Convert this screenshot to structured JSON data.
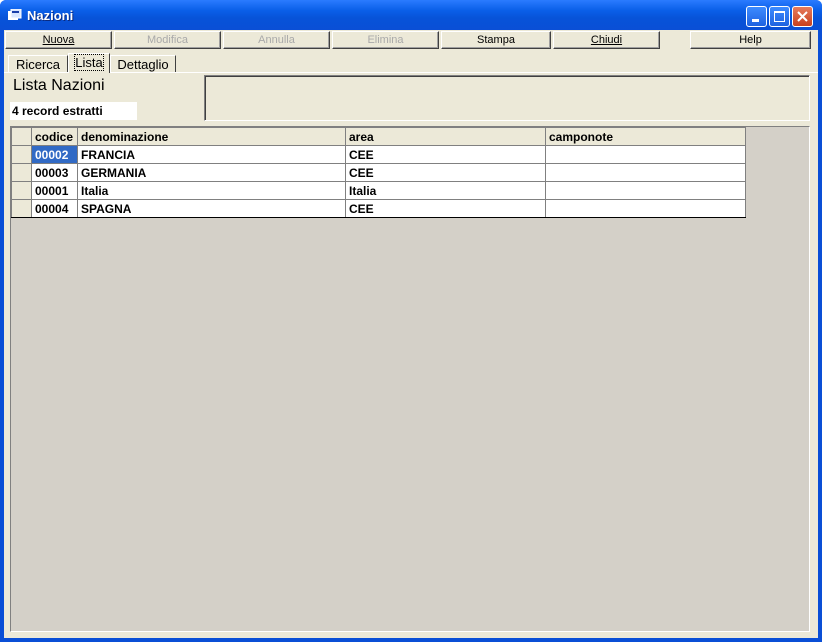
{
  "window": {
    "title": "Nazioni"
  },
  "toolbar": [
    {
      "label": "Nuova",
      "enabled": true
    },
    {
      "label": "Modifica",
      "enabled": false
    },
    {
      "label": "Annulla",
      "enabled": false
    },
    {
      "label": "Elimina",
      "enabled": false
    },
    {
      "label": "Stampa",
      "enabled": true
    },
    {
      "label": "Chiudi",
      "enabled": true
    },
    {
      "label": "Help",
      "enabled": true
    }
  ],
  "tabs": [
    {
      "label": "Ricerca",
      "active": false
    },
    {
      "label": "Lista",
      "active": true
    },
    {
      "label": "Dettaglio",
      "active": false
    }
  ],
  "panel": {
    "title": "Lista Nazioni",
    "record_count": "4 record estratti"
  },
  "grid": {
    "columns": [
      "codice",
      "denominazione",
      "area",
      "camponote"
    ],
    "rows": [
      {
        "codice": "00002",
        "denominazione": "FRANCIA",
        "area": "CEE",
        "camponote": ""
      },
      {
        "codice": "00003",
        "denominazione": "GERMANIA",
        "area": "CEE",
        "camponote": ""
      },
      {
        "codice": "00001",
        "denominazione": "Italia",
        "area": "Italia",
        "camponote": ""
      },
      {
        "codice": "00004",
        "denominazione": "SPAGNA",
        "area": "CEE",
        "camponote": ""
      }
    ]
  },
  "colors": {
    "titlebar": "#0a4fd6",
    "selection": "#316ac5",
    "face": "#ece9d8",
    "grid_bg": "#d4d0c8"
  }
}
